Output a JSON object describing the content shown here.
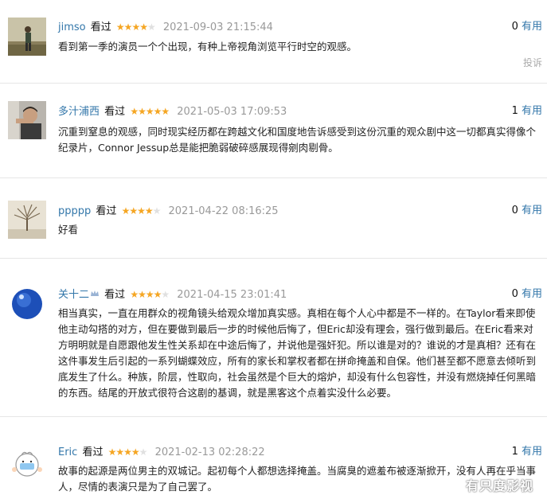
{
  "reviews": [
    {
      "username": "jimso",
      "watched": "看过",
      "rating": 4,
      "time": "2021-09-03 21:15:44",
      "useful_count": "0",
      "useful_label": "有用",
      "content": "看到第一季的演员一个个出现，有种上帝视角浏览平行时空的观感。",
      "report": "投诉"
    },
    {
      "username": "多汁浦西",
      "watched": "看过",
      "rating": 5,
      "time": "2021-05-03 17:09:53",
      "useful_count": "1",
      "useful_label": "有用",
      "content": "沉重到窒息的观感，同时现实经历都在跨越文化和国度地告诉感受到这份沉重的观众剧中这一切都真实得像个纪录片，Connor Jessup总是能把脆弱破碎感展现得剜肉剔骨。"
    },
    {
      "username": "ppppp",
      "watched": "看过",
      "rating": 4,
      "time": "2021-04-22 08:16:25",
      "useful_count": "0",
      "useful_label": "有用",
      "content": "好看"
    },
    {
      "username": "关十二",
      "watched": "看过",
      "rating": 4,
      "time": "2021-04-15 23:01:41",
      "useful_count": "0",
      "useful_label": "有用",
      "content": "相当真实，一直在用群众的视角镜头给观众增加真实感。真相在每个人心中都是不一样的。在Taylor看来即使他主动勾搭的对方，但在要做到最后一步的时候他后悔了，但Eric却没有理会，强行做到最后。在Eric看来对方明明就是自愿跟他发生性关系却在中途后悔了，并说他是强奸犯。所以谁是对的？谁说的才是真相？还有在这件事发生后引起的一系列蝴蝶效应，所有的家长和掌权者都在拼命掩盖和自保。他们甚至都不愿意去倾听到底发生了什么。种族，阶层，性取向，社会虽然是个巨大的熔炉，却没有什么包容性，并没有燃烧掉任何黑暗的东西。结尾的开放式很符合这剧的基调，就是黑客这个点着实没什么必要。"
    },
    {
      "username": "Eric",
      "watched": "看过",
      "rating": 4,
      "time": "2021-02-13 02:28:22",
      "useful_count": "1",
      "useful_label": "有用",
      "content": "故事的起源是两位男主的双城记。起初每个人都想选择掩盖。当腐臭的遮羞布被逐渐掀开，没有人再在乎当事人，尽情的表演只是为了自己罢了。"
    }
  ],
  "watermark": "有只度影视",
  "colors": {
    "link": "#3377aa",
    "star": "#f5a623",
    "time": "#999999"
  }
}
